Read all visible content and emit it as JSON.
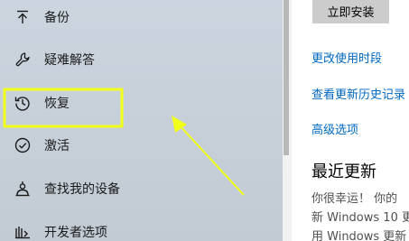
{
  "sidebar": {
    "items": [
      {
        "label": "备份",
        "icon": "upload-arrow-icon"
      },
      {
        "label": "疑难解答",
        "icon": "wrench-icon"
      },
      {
        "label": "恢复",
        "icon": "history-icon"
      },
      {
        "label": "激活",
        "icon": "check-circle-icon"
      },
      {
        "label": "查找我的设备",
        "icon": "person-locate-icon"
      },
      {
        "label": "开发者选项",
        "icon": "developer-tools-icon"
      }
    ]
  },
  "main": {
    "install_button": "立即安装",
    "links": [
      "更改使用时段",
      "查看更新历史记录",
      "高级选项"
    ],
    "recent_updates_title": "最近更新",
    "body_lines": [
      "你很幸运！ 你的",
      "新 Windows 10 更",
      "用 Windows 更新"
    ]
  },
  "annotation": {
    "color": "#f2ff1a",
    "target": "恢复"
  }
}
